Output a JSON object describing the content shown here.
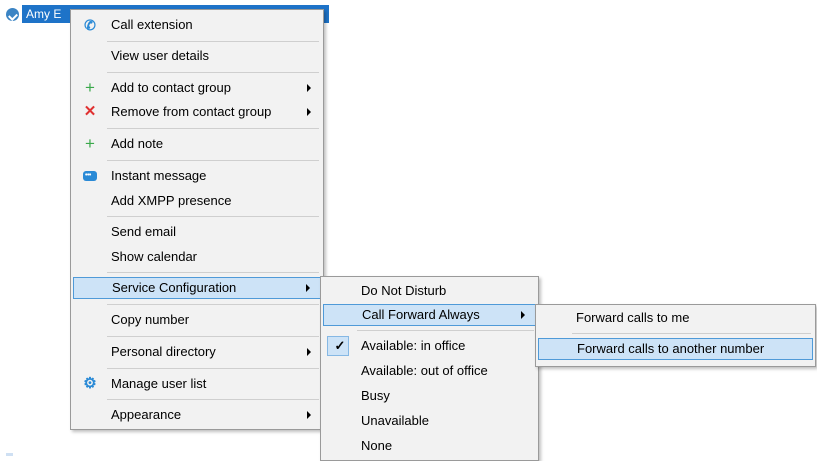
{
  "user": {
    "name": "Amy E"
  },
  "main_menu": {
    "items": [
      {
        "label": "Call extension",
        "icon": "phone-icon"
      },
      {
        "label": "View user details"
      },
      {
        "label": "Add to contact group",
        "icon": "plus-icon",
        "submenu": true
      },
      {
        "label": "Remove from contact group",
        "icon": "cross-icon",
        "submenu": true
      },
      {
        "label": "Add note",
        "icon": "plus-icon"
      },
      {
        "label": "Instant message",
        "icon": "chat-icon"
      },
      {
        "label": "Add XMPP presence"
      },
      {
        "label": "Send email"
      },
      {
        "label": "Show calendar"
      },
      {
        "label": "Service Configuration",
        "submenu": true,
        "highlighted": true
      },
      {
        "label": "Copy number"
      },
      {
        "label": "Personal directory",
        "submenu": true
      },
      {
        "label": "Manage user list",
        "icon": "gear-icon"
      },
      {
        "label": "Appearance",
        "submenu": true
      }
    ]
  },
  "service_menu": {
    "items": [
      {
        "label": "Do Not Disturb"
      },
      {
        "label": "Call Forward Always",
        "submenu": true,
        "highlighted": true
      },
      {
        "label": "Available: in office",
        "checked": true
      },
      {
        "label": "Available: out of office"
      },
      {
        "label": "Busy"
      },
      {
        "label": "Unavailable"
      },
      {
        "label": "None"
      }
    ]
  },
  "forward_menu": {
    "items": [
      {
        "label": "Forward calls to me"
      },
      {
        "label": "Forward calls to another number",
        "highlighted": true
      }
    ]
  },
  "colors": {
    "accent": "#1e73c8",
    "highlight": "#cde3f7",
    "highlight_border": "#4f9ad8",
    "menu_bg": "#f2f2f2"
  }
}
